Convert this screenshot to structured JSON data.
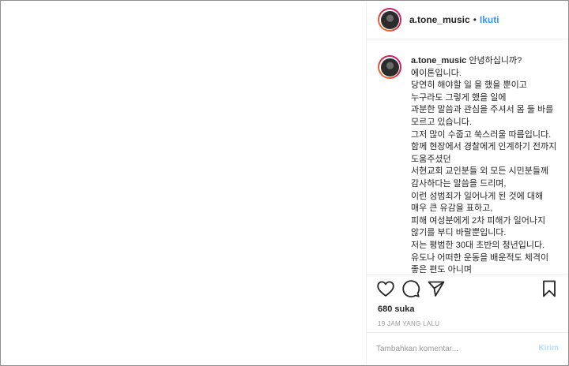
{
  "header": {
    "username": "a.tone_music",
    "separator": "•",
    "follow_label": "Ikuti"
  },
  "caption": {
    "username": "a.tone_music",
    "text": "안녕하십니까? 에이톤입니다.\n당연히 해야할 일 을 했을 뿐이고 누구라도 그렇게 했을 일에\n과분한 말씀과 관심을 주셔서 몸 둘 바를 모르고 있습니다.\n그저 많이 수줍고 쑥스러울 따름입니다.\n함께 현장에서 경찰에게 인계하기 전까지 도움주셨던\n서현교회 교인분들 외 모든 시민분들께 감사하다는 말씀을 드리며,\n이런 성범죄가 일어나게 된 것에 대해 매우 큰 유감을 표하고,\n피해 여성분에게 2차 피해가 일어나지 않기를 부디 바랄뿐입니다.\n저는 평범한 30대 초반의 청년입니다.\n유도나 어떠한 운동을 배운적도 체격이 좋은 편도 아니며\n체력 또한 평균 이하 일지도 모르겠습"
  },
  "icons": {
    "like": "heart-icon",
    "comment": "comment-icon",
    "share": "share-icon",
    "save": "bookmark-icon"
  },
  "likes": "680 suka",
  "timestamp": "19 JAM YANG LALU",
  "comment": {
    "placeholder": "Tambahkan komentar...",
    "submit_label": "Kirim"
  },
  "colors": {
    "link": "#3897f0",
    "submit_disabled": "#b2dffc",
    "meta": "#999999"
  }
}
